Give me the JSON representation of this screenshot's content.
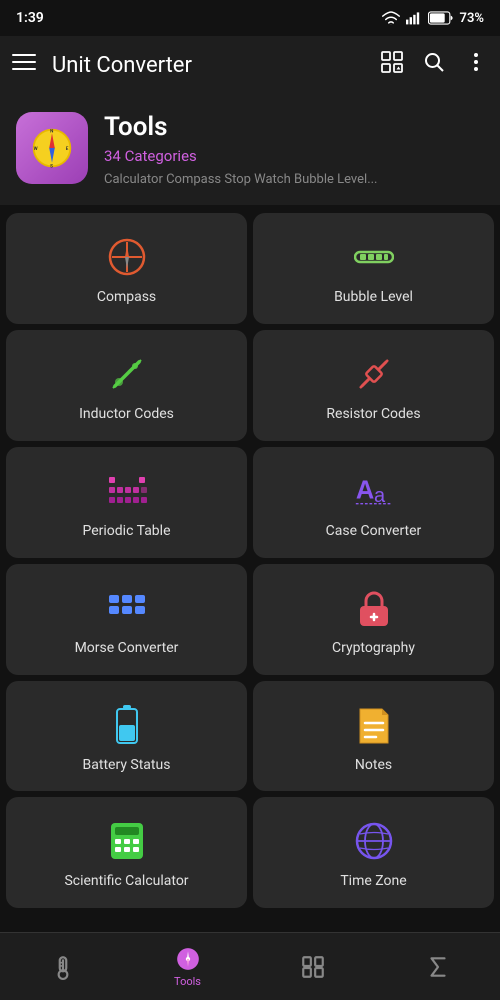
{
  "statusBar": {
    "time": "1:39",
    "battery": "73%"
  },
  "appBar": {
    "menuIcon": "menu-icon",
    "title": "Unit Converter",
    "favGridIcon": "fav-grid-icon",
    "searchIcon": "search-icon",
    "moreIcon": "more-vert-icon"
  },
  "headerCard": {
    "title": "Tools",
    "subtitle": "34 Categories",
    "description": "Calculator Compass Stop Watch Bubble Level..."
  },
  "tools": [
    {
      "id": "compass",
      "label": "Compass",
      "color": "#e05a30"
    },
    {
      "id": "bubble-level",
      "label": "Bubble Level",
      "color": "#80d060"
    },
    {
      "id": "inductor-codes",
      "label": "Inductor Codes",
      "color": "#55cc44"
    },
    {
      "id": "resistor-codes",
      "label": "Resistor Codes",
      "color": "#e05050"
    },
    {
      "id": "periodic-table",
      "label": "Periodic Table",
      "color": "#e040b0"
    },
    {
      "id": "case-converter",
      "label": "Case Converter",
      "color": "#8855ee"
    },
    {
      "id": "morse-converter",
      "label": "Morse Converter",
      "color": "#5588ff"
    },
    {
      "id": "cryptography",
      "label": "Cryptography",
      "color": "#e05060"
    },
    {
      "id": "battery-status",
      "label": "Battery Status",
      "color": "#40c8f0"
    },
    {
      "id": "notes",
      "label": "Notes",
      "color": "#f0b030"
    },
    {
      "id": "scientific-calculator",
      "label": "Scientific Calculator",
      "color": "#44cc44"
    },
    {
      "id": "time-zone",
      "label": "Time Zone",
      "color": "#7755ee"
    }
  ],
  "bottomNav": {
    "items": [
      {
        "id": "thermometer",
        "label": ""
      },
      {
        "id": "tools",
        "label": "Tools",
        "active": true
      },
      {
        "id": "converter",
        "label": ""
      },
      {
        "id": "sigma",
        "label": ""
      }
    ]
  }
}
